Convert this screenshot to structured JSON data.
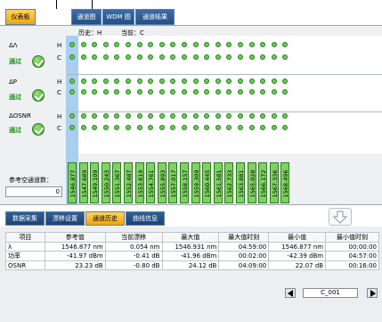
{
  "top_tabs": [
    "仪表板",
    "通道图",
    "WDM 图",
    "通道结果"
  ],
  "header": {
    "history": "历史：H",
    "current": "当前：C"
  },
  "metrics": [
    {
      "name": "ΔΛ",
      "status": "通过",
      "h": "H",
      "c": "C"
    },
    {
      "name": "ΔP",
      "status": "通过",
      "h": "H",
      "c": "C"
    },
    {
      "name": "ΔOSNR",
      "status": "通过",
      "h": "H",
      "c": "C"
    }
  ],
  "channels": [
    "1546.877",
    "1547.689",
    "1549.109",
    "1550.243",
    "1551.367",
    "1552.487",
    "1553.619",
    "1554.761",
    "1555.893",
    "1557.017",
    "1558.157",
    "1559.309",
    "1560.445",
    "1561.581",
    "1562.733",
    "1563.881",
    "1565.028",
    "1566.172",
    "1567.336",
    "1568.496"
  ],
  "ref_channels": {
    "label": "参考空通道数：",
    "value": "0"
  },
  "bottom_tabs": [
    "数据采集",
    "漂移设置",
    "通道历史",
    "曲线信息"
  ],
  "table": {
    "headers": [
      "项目",
      "参考值",
      "当前漂移",
      "最大值",
      "最大值时刻",
      "最小值",
      "最小值时刻"
    ],
    "rows": [
      [
        "λ",
        "1546.877 nm",
        "0.054 nm",
        "1546.931 nm",
        "04:59:00",
        "1546.877 nm",
        "00:00:00"
      ],
      [
        "功率",
        "-41.97 dBm",
        "-0.41 dB",
        "-41.96 dBm",
        "00:02:00",
        "-42.39 dBm",
        "04:57:00"
      ],
      [
        "OSNR",
        "23.23 dB",
        "-0.80 dB",
        "24.12 dB",
        "04:09:00",
        "22.07 dB",
        "00:16:00"
      ]
    ]
  },
  "pager": {
    "label": "C_001"
  },
  "colors": {
    "accent_active": "#f1a40a",
    "tab_blue": "#234f86",
    "dot_green": "#5fd14a",
    "highlight_blue": "#a8cff0"
  },
  "icons": {
    "pass": "check-circle-icon",
    "collapse": "down-arrow-icon",
    "prev": "left-triangle-icon",
    "next": "right-triangle-icon"
  }
}
